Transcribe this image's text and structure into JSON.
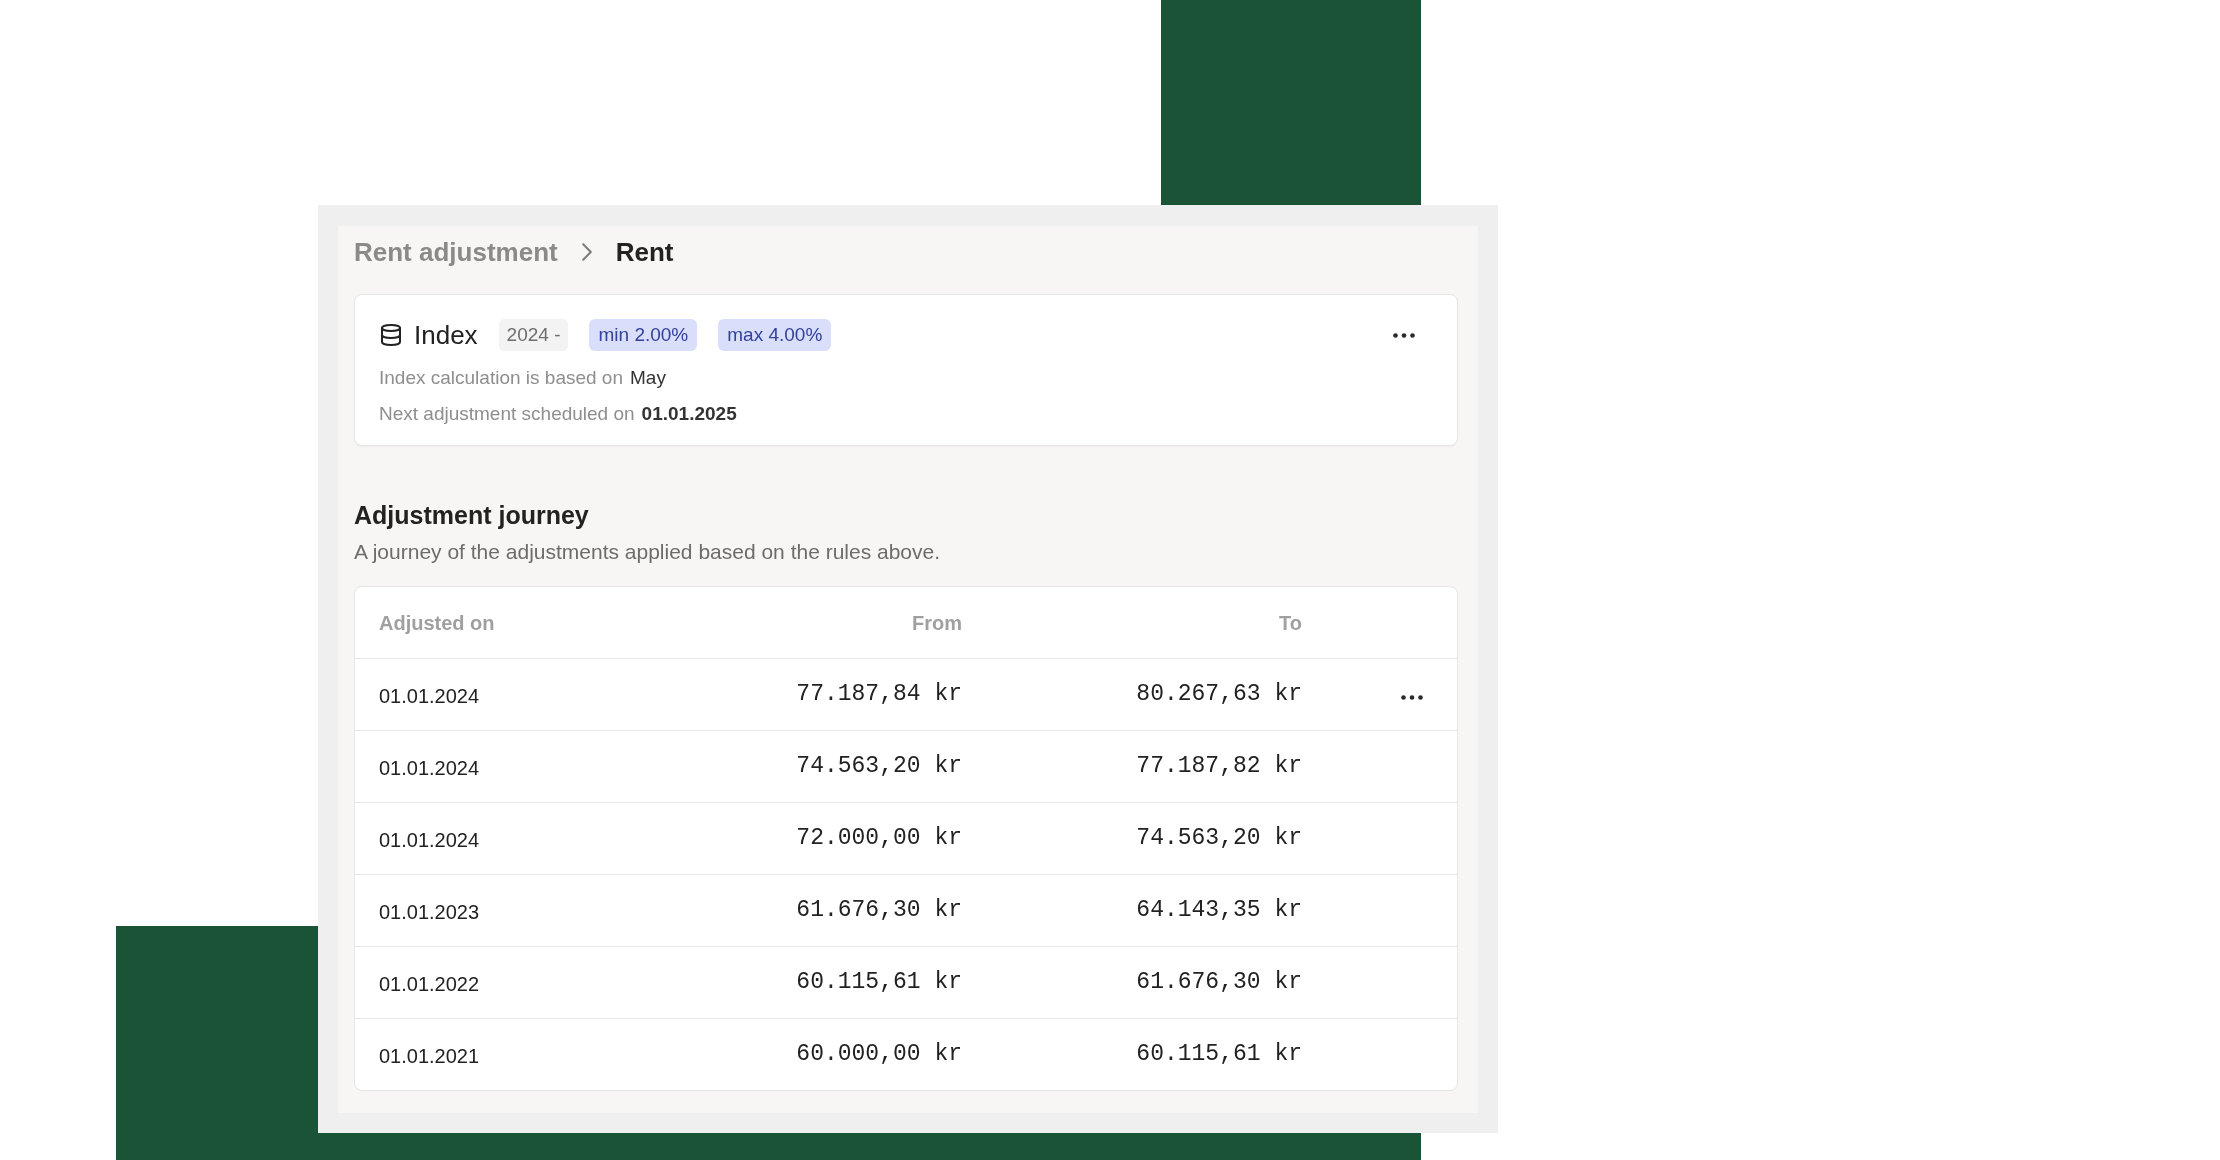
{
  "breadcrumb": [
    {
      "label": "Rent adjustment",
      "current": false
    },
    {
      "label": "Rent",
      "current": true
    }
  ],
  "index_rule": {
    "title": "Index",
    "period": "2024 -",
    "limits": [
      "min 2.00%",
      "max 4.00%"
    ],
    "details": [
      {
        "label": "Index calculation is based on",
        "value": "May"
      },
      {
        "label": "Next adjustment scheduled on",
        "value": "01.01.2025"
      }
    ]
  },
  "adjustment_journey": {
    "title": "Adjustment journey",
    "description": "A journey of the adjustments applied based on the rules above.",
    "columns": [
      "Adjusted on",
      "From",
      "To"
    ],
    "rows": [
      {
        "adjusted_on": "01.01.2024",
        "from": "77.187,84 kr",
        "to": "80.267,63 kr",
        "actions_visible": true
      },
      {
        "adjusted_on": "01.01.2024",
        "from": "74.563,20 kr",
        "to": "77.187,82 kr",
        "actions_visible": false
      },
      {
        "adjusted_on": "01.01.2024",
        "from": "72.000,00 kr",
        "to": "74.563,20 kr",
        "actions_visible": false
      },
      {
        "adjusted_on": "01.01.2023",
        "from": "61.676,30 kr",
        "to": "64.143,35 kr",
        "actions_visible": false
      },
      {
        "adjusted_on": "01.01.2022",
        "from": "60.115,61 kr",
        "to": "61.676,30 kr",
        "actions_visible": false
      },
      {
        "adjusted_on": "01.01.2021",
        "from": "60.000,00 kr",
        "to": "60.115,61 kr",
        "actions_visible": false
      }
    ]
  }
}
